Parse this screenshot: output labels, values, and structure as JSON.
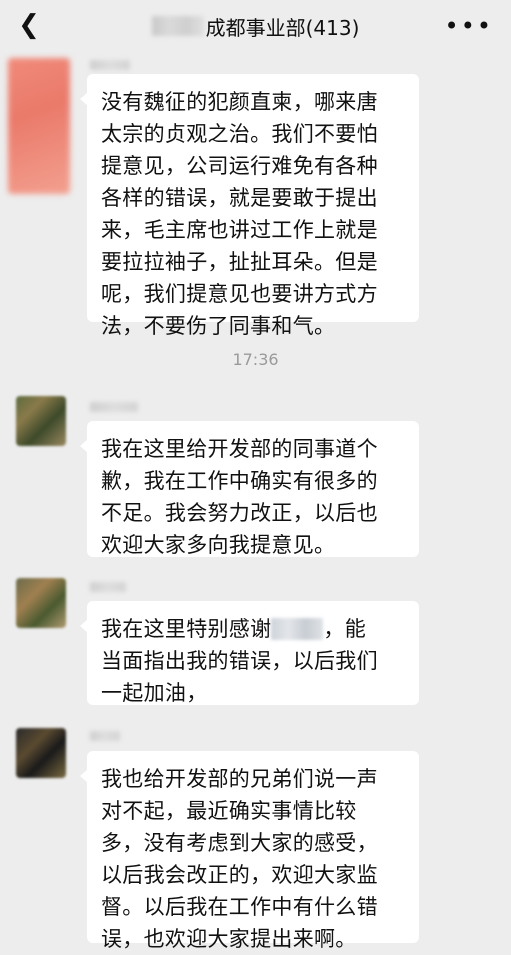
{
  "header": {
    "back_icon": "chevron-left-icon",
    "title": "成都事业部(413)",
    "more_icon": "ellipsis-icon"
  },
  "messages": [
    {
      "text": "没有魏征的犯颜直柬，哪来唐\n太宗的贞观之治。我们不要怕\n提意见，公司运行难免有各种\n各样的错误，就是要敢于提出\n来，毛主席也讲过工作上就是\n要拉拉袖子，扯扯耳朵。但是\n呢，我们提意见也要讲方式方\n法，不要伤了同事和气。"
    },
    {
      "text": "我在这里给开发部的同事道个\n歉，我在工作中确实有很多的\n不足。我会努力改正，以后也\n欢迎大家多向我提意见。"
    },
    {
      "text_before": "我在这里特别感谢",
      "text_after": "，能\n当面指出我的错误，以后我们\n一起加油，"
    },
    {
      "text": "我也给开发部的兄弟们说一声\n对不起，最近确实事情比较\n多，没有考虑到大家的感受，\n以后我会改正的，欢迎大家监\n督。以后我在工作中有什么错\n误，也欢迎大家提出来啊。"
    }
  ],
  "timestamp": "17:36"
}
